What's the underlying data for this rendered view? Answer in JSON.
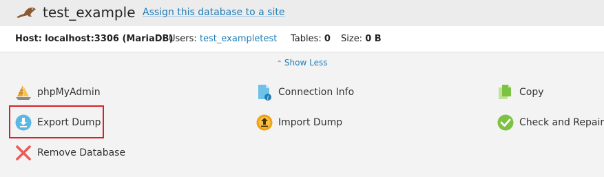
{
  "header": {
    "db_name": "test_example",
    "assign_link": "Assign this database to a site",
    "db_icon": "mariadb-seal-icon"
  },
  "info": {
    "host_label": "Host:",
    "host_value": "localhost:3306 (MariaDB)",
    "users_label": "Users:",
    "users_value": "test_exampletest",
    "tables_label": "Tables:",
    "tables_value": "0",
    "size_label": "Size:",
    "size_value": "0 B"
  },
  "toggle": {
    "icon": "chevron-up-icon",
    "label": "Show Less"
  },
  "actions": {
    "phpmyadmin": {
      "label": "phpMyAdmin",
      "icon": "phpmyadmin-sail-icon"
    },
    "connection_info": {
      "label": "Connection Info",
      "icon": "document-info-icon"
    },
    "copy": {
      "label": "Copy",
      "icon": "copy-documents-icon"
    },
    "export_dump": {
      "label": "Export Dump",
      "icon": "download-circle-icon"
    },
    "import_dump": {
      "label": "Import Dump",
      "icon": "upload-circle-icon"
    },
    "check_repair": {
      "label": "Check and Repair",
      "icon": "checkmark-circle-icon"
    },
    "remove_database": {
      "label": "Remove Database",
      "icon": "red-x-icon"
    }
  },
  "colors": {
    "link": "#1f7db8",
    "highlight": "#d91f26",
    "export_icon": "#5bb7e6",
    "import_icon": "#f0a20c",
    "check_icon": "#7dc243",
    "remove_icon": "#ea5a57"
  }
}
